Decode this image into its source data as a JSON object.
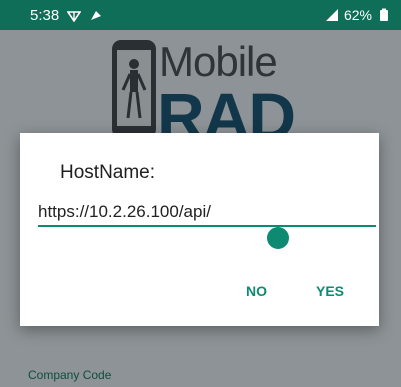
{
  "status_bar": {
    "time": "5:38",
    "battery": "62%",
    "left_icons": [
      "wifi-icon",
      "notification-icon"
    ],
    "right_icons": [
      "signal-icon",
      "battery-icon"
    ]
  },
  "logo": {
    "word_top": "Mobile",
    "word_bottom": "RAD"
  },
  "background": {
    "company_label": "Company Code"
  },
  "dialog": {
    "title": "HostName:",
    "input_value": "https://10.2.26.100/api/",
    "no_label": "NO",
    "yes_label": "YES"
  },
  "colors": {
    "accent": "#0f8a72",
    "status_bar": "#0f6e58",
    "logo_dark": "#12374a"
  }
}
